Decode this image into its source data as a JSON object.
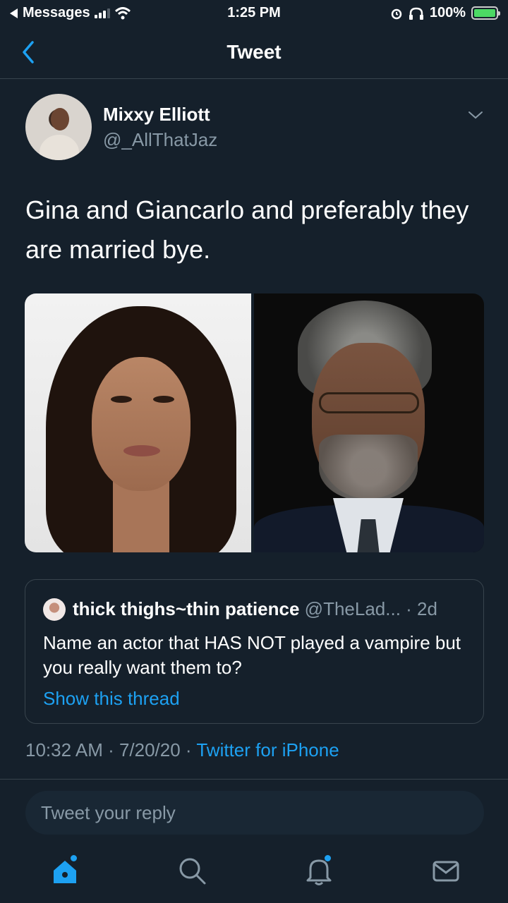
{
  "status_bar": {
    "back_app": "Messages",
    "time": "1:25 PM",
    "battery_percent": "100%"
  },
  "nav": {
    "title": "Tweet",
    "back_icon": "chevron-left-icon"
  },
  "tweet": {
    "author_name": "Mixxy Elliott",
    "author_handle": "@_AllThatJaz",
    "text": "Gina and Giancarlo and preferably they are married bye.",
    "timestamp": "10:32 AM · 7/20/20 · ",
    "source": "Twitter for iPhone",
    "media_count": 2
  },
  "quoted_tweet": {
    "author_name": "thick thighs~thin patience",
    "author_handle": "@TheLad...",
    "age": " · 2d",
    "text": "Name an actor that HAS NOT played a vampire but you really want them to?",
    "link": "Show this thread"
  },
  "reply": {
    "placeholder": "Tweet your reply"
  },
  "tab_bar": {
    "items": [
      "home-icon",
      "search-icon",
      "notifications-icon",
      "messages-icon"
    ]
  },
  "colors": {
    "background": "#15202b",
    "accent": "#1da1f2",
    "secondary_text": "#8899a6",
    "border": "#38444d"
  }
}
